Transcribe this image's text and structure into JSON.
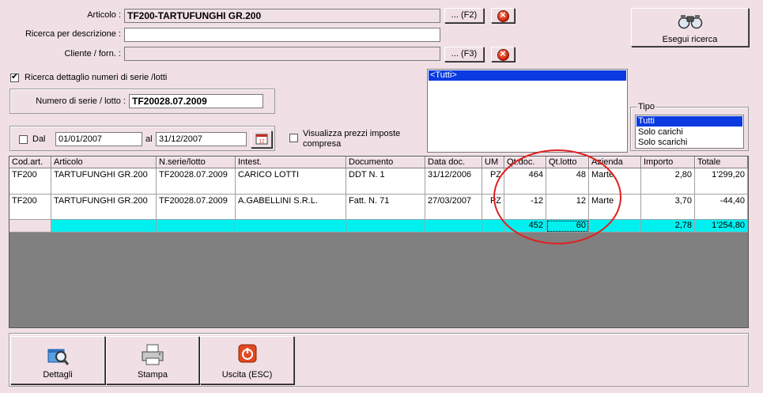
{
  "form": {
    "articolo_label": "Articolo :",
    "articolo_value": "TF200-TARTUFUNGHI GR.200",
    "f2_label": "... (F2)",
    "ricerca_label": "Ricerca per descrizione :",
    "ricerca_value": "",
    "cliente_label": "Cliente / forn. :",
    "cliente_value": "",
    "f3_label": "... (F3)",
    "dettaglio_checkbox_label": "Ricerca dettaglio numeri di serie /lotti",
    "dettaglio_checked": true,
    "numero_serie_label": "Numero di serie / lotto :",
    "numero_serie_value": "TF20028.07.2009",
    "dal_label": "Dal",
    "dal_checked": false,
    "dal_value": "01/01/2007",
    "al_label": "al",
    "al_value": "31/12/2007",
    "prezzi_label_line1": "Visualizza prezzi imposte",
    "prezzi_label_line2": "compresa",
    "prezzi_checked": false
  },
  "search_button": {
    "label": "Esegui ricerca",
    "icon": "binoculars-icon"
  },
  "aziende_list": {
    "selected": "<Tutti>"
  },
  "tipo": {
    "title": "Tipo",
    "options": [
      "Tutti",
      "Solo carichi",
      "Solo scarichi"
    ],
    "selected": "Tutti"
  },
  "grid": {
    "columns": [
      "Cod.art.",
      "Articolo",
      "N.serie/lotto",
      "Intest.",
      "Documento",
      "Data doc.",
      "UM",
      "Qt.doc.",
      "Qt.lotto",
      "Azienda",
      "Importo",
      "Totale"
    ],
    "rows": [
      [
        "TF200",
        "TARTUFUNGHI GR.200",
        "TF20028.07.2009",
        "CARICO LOTTI",
        "DDT N. 1",
        "31/12/2006",
        "PZ",
        "464",
        "48",
        "Marte",
        "2,80",
        "1'299,20"
      ],
      [
        "TF200",
        "TARTUFUNGHI GR.200",
        "TF20028.07.2009",
        "A.GABELLINI S.R.L.",
        "Fatt. N. 71",
        "27/03/2007",
        "PZ",
        "-12",
        "12",
        "Marte",
        "3,70",
        "-44,40"
      ]
    ],
    "totals": [
      "",
      "",
      "",
      "",
      "",
      "",
      "",
      "452",
      "60",
      "",
      "2,78",
      "1'254,80"
    ],
    "highlight_color": "#00f0f0"
  },
  "buttons": {
    "dettagli": "Dettagli",
    "stampa": "Stampa",
    "uscita": "Uscita (ESC)"
  },
  "colors": {
    "window_bg": "#f0e0e6",
    "selection": "#0a3ae0",
    "annotation": "#e02020"
  }
}
